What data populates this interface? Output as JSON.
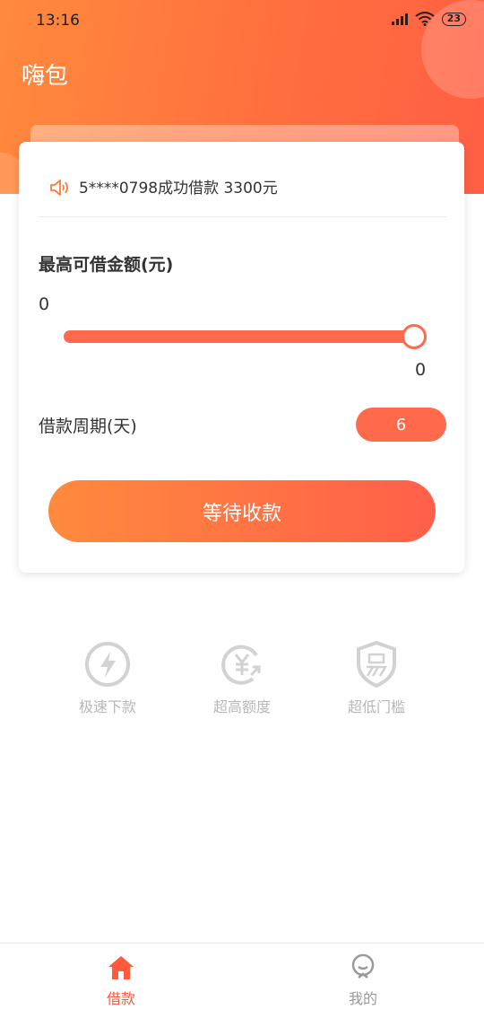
{
  "status_bar": {
    "time": "13:16",
    "battery": "23"
  },
  "app": {
    "title": "嗨包"
  },
  "notice": {
    "text": "5****0798成功借款 3300元"
  },
  "loan": {
    "max_amount_label": "最高可借金额(元)",
    "min_value": "0",
    "max_value": "0",
    "slider_fraction": 1.0,
    "period_label": "借款周期(天)",
    "period_value": "6",
    "action_label": "等待收款"
  },
  "features": [
    {
      "label": "极速下款",
      "icon": "lightning-icon"
    },
    {
      "label": "超高额度",
      "icon": "yen-arrow-icon"
    },
    {
      "label": "超低门槛",
      "icon": "shield-easy-icon"
    }
  ],
  "tabs": [
    {
      "label": "借款",
      "icon": "home-icon",
      "active": true
    },
    {
      "label": "我的",
      "icon": "profile-icon",
      "active": false
    }
  ],
  "colors": {
    "accent": "#ff6a4c",
    "accent_start": "#ff8a3d",
    "inactive": "#999999",
    "feature_gray": "#cfcfcf"
  }
}
